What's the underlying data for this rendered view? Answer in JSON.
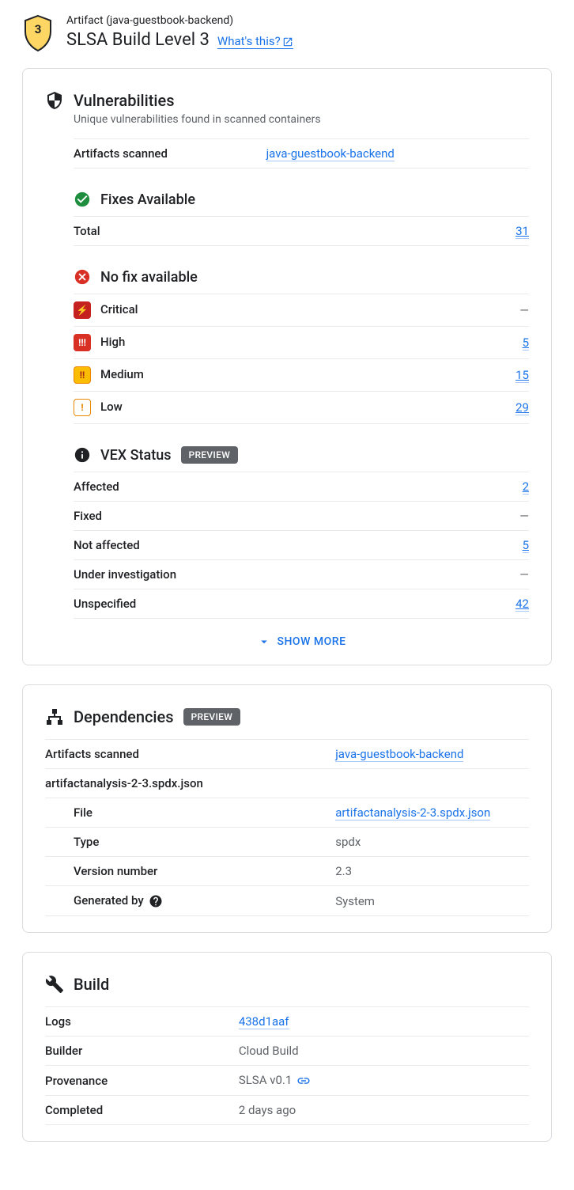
{
  "header": {
    "artifact_label": "Artifact (java-guestbook-backend)",
    "title": "SLSA Build Level 3",
    "whats_this": "What's this?"
  },
  "vulnerabilities": {
    "title": "Vulnerabilities",
    "subtitle": "Unique vulnerabilities found in scanned containers",
    "artifacts_scanned_label": "Artifacts scanned",
    "artifacts_scanned_value": "java-guestbook-backend",
    "fixes_available": {
      "title": "Fixes Available",
      "total_label": "Total",
      "total_value": "31"
    },
    "no_fix": {
      "title": "No fix available",
      "rows": [
        {
          "label": "Critical",
          "value": "—",
          "sev": "critical",
          "link": false
        },
        {
          "label": "High",
          "value": "5",
          "sev": "high",
          "link": true
        },
        {
          "label": "Medium",
          "value": "15",
          "sev": "medium",
          "link": true
        },
        {
          "label": "Low",
          "value": "29",
          "sev": "low",
          "link": true
        }
      ]
    },
    "vex": {
      "title": "VEX Status",
      "badge": "PREVIEW",
      "rows": [
        {
          "label": "Affected",
          "value": "2",
          "link": true
        },
        {
          "label": "Fixed",
          "value": "—",
          "link": false
        },
        {
          "label": "Not affected",
          "value": "5",
          "link": true
        },
        {
          "label": "Under investigation",
          "value": "—",
          "link": false
        },
        {
          "label": "Unspecified",
          "value": "42",
          "link": true
        }
      ]
    },
    "show_more": "SHOW MORE"
  },
  "dependencies": {
    "title": "Dependencies",
    "badge": "PREVIEW",
    "artifacts_scanned_label": "Artifacts scanned",
    "artifacts_scanned_value": "java-guestbook-backend",
    "file_header": "artifactanalysis-2-3.spdx.json",
    "rows": [
      {
        "label": "File",
        "value": "artifactanalysis-2-3.spdx.json",
        "link": true
      },
      {
        "label": "Type",
        "value": "spdx",
        "link": false
      },
      {
        "label": "Version number",
        "value": "2.3",
        "link": false
      },
      {
        "label": "Generated by",
        "value": "System",
        "link": false,
        "help": true
      }
    ]
  },
  "build": {
    "title": "Build",
    "rows": [
      {
        "label": "Logs",
        "value": "438d1aaf",
        "link": true
      },
      {
        "label": "Builder",
        "value": "Cloud Build",
        "link": false
      },
      {
        "label": "Provenance",
        "value": "SLSA v0.1",
        "link": false,
        "linkicon": true
      },
      {
        "label": "Completed",
        "value": "2 days ago",
        "link": false
      }
    ]
  }
}
